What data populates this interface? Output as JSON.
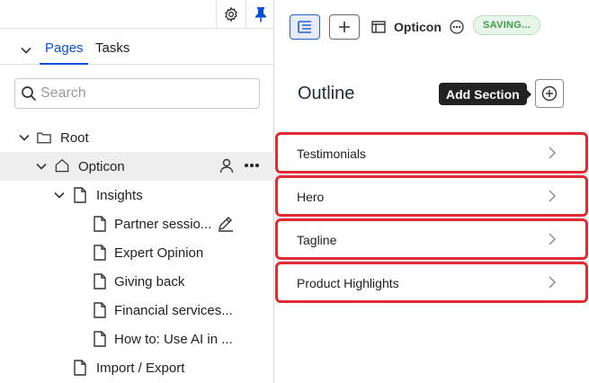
{
  "sidebar": {
    "tabs": [
      {
        "label": "Pages",
        "active": true
      },
      {
        "label": "Tasks",
        "active": false
      }
    ],
    "search": {
      "placeholder": "Search",
      "value": ""
    },
    "tree": [
      {
        "label": "Root",
        "icon": "folder-icon",
        "level": 0,
        "expanded": true
      },
      {
        "label": "Opticon",
        "icon": "home-icon",
        "level": 1,
        "expanded": true,
        "selected": true
      },
      {
        "label": "Insights",
        "icon": "page-icon",
        "level": 2,
        "expanded": true
      },
      {
        "label": "Partner sessio...",
        "icon": "page-icon",
        "level": 3
      },
      {
        "label": "Expert Opinion",
        "icon": "page-icon",
        "level": 3
      },
      {
        "label": "Giving back",
        "icon": "page-icon",
        "level": 3
      },
      {
        "label": "Financial services...",
        "icon": "page-icon",
        "level": 3
      },
      {
        "label": "How to: Use AI in ...",
        "icon": "page-icon",
        "level": 3
      },
      {
        "label": "Import / Export",
        "icon": "page-icon",
        "level": 2
      }
    ]
  },
  "header": {
    "site_name": "Opticon",
    "status": "SAVING..."
  },
  "outline": {
    "title": "Outline",
    "tooltip": "Add Section",
    "sections": [
      {
        "label": "Testimonials"
      },
      {
        "label": "Hero"
      },
      {
        "label": "Tagline"
      },
      {
        "label": "Product Highlights"
      }
    ]
  },
  "colors": {
    "accent": "#0b4fd6",
    "highlight": "#e02b35",
    "saving": "#3d9a4b"
  }
}
